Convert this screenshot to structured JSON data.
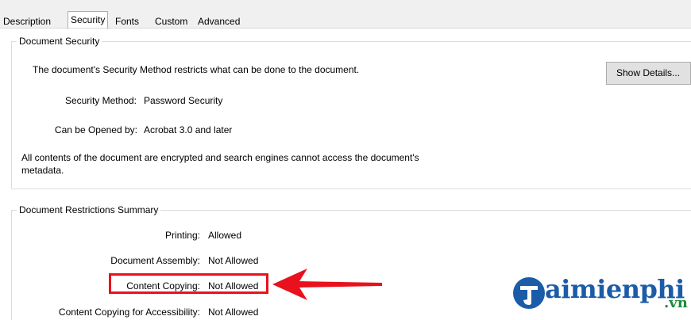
{
  "tabs": [
    {
      "label": "Description",
      "selected": false
    },
    {
      "label": "Security",
      "selected": true
    },
    {
      "label": "Fonts",
      "selected": false
    },
    {
      "label": "Custom",
      "selected": false
    },
    {
      "label": "Advanced",
      "selected": false
    }
  ],
  "document_security": {
    "legend": "Document Security",
    "intro": "The document's Security Method restricts what can be done to the document.",
    "security_method_label": "Security Method:",
    "security_method_value": "Password Security",
    "opened_by_label": "Can be Opened by:",
    "opened_by_value": "Acrobat 3.0 and later",
    "encryption_note_line1": "All contents of the document are encrypted and search engines cannot access the document's",
    "encryption_note_line2": "metadata.",
    "show_details_button": "Show Details..."
  },
  "restrictions": {
    "legend": "Document Restrictions Summary",
    "rows": [
      {
        "label": "Printing:",
        "value": "Allowed"
      },
      {
        "label": "Document Assembly:",
        "value": "Not Allowed"
      },
      {
        "label": "Content Copying:",
        "value": "Not Allowed"
      },
      {
        "label": "Content Copying for Accessibility:",
        "value": "Not Allowed"
      }
    ]
  },
  "annotation": {
    "highlight_color": "#e8111d"
  },
  "watermark": {
    "brand": "aimienphi",
    "suffix": ".vn",
    "brand_color": "#1b5ca8",
    "suffix_color": "#1b8a3a"
  }
}
